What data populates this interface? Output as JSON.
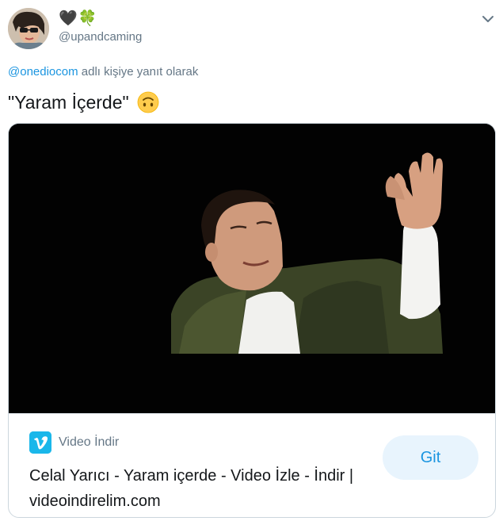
{
  "user": {
    "display_name_emoji": "🖤🍀",
    "handle": "@upandcaming",
    "avatar_icon": "avatar-photo"
  },
  "reply": {
    "mention": "@onediocom",
    "suffix": " adlı kişiye yanıt olarak"
  },
  "tweet": {
    "text": "\"Yaram İçerde\"",
    "emoji_icon": "upside-down-face-icon"
  },
  "card": {
    "source": "Video İndir",
    "source_icon": "vimeo-icon",
    "title": "Celal Yarıcı - Yaram içerde - Video İzle - İndir | videoindirelim.com",
    "button_label": "Git",
    "accent_color": "#1b95e0",
    "vimeo_color": "#1ab7ea"
  }
}
